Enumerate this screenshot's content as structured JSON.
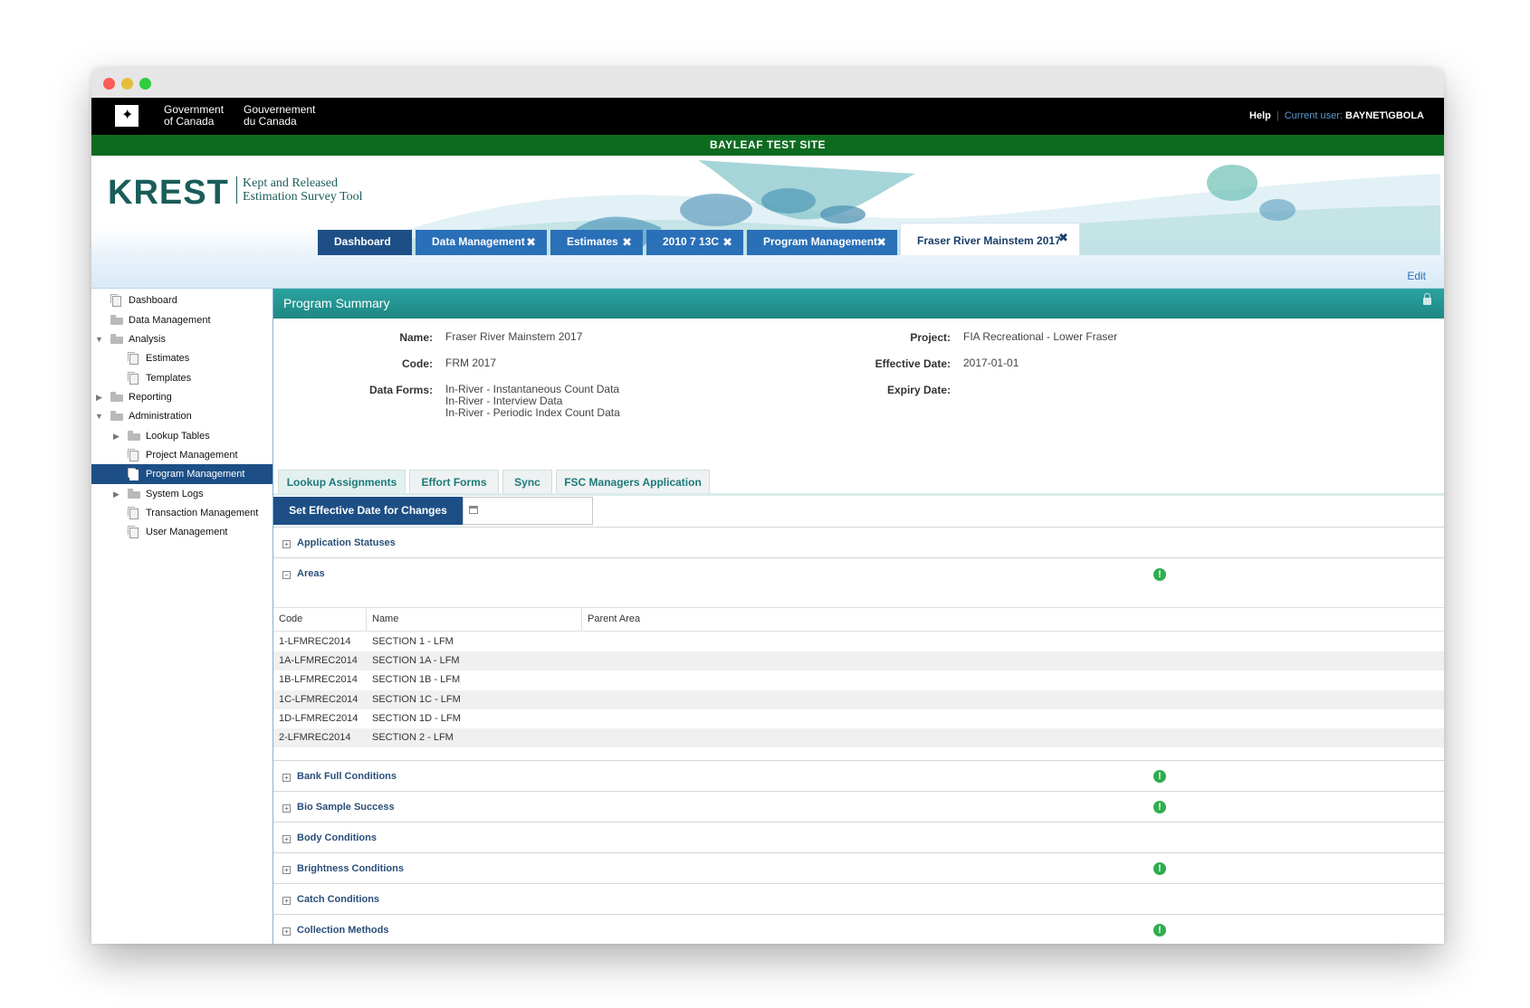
{
  "gov": {
    "en_line1": "Government",
    "en_line2": "of Canada",
    "fr_line1": "Gouvernement",
    "fr_line2": "du Canada",
    "help": "Help",
    "current_user_label": "Current user:",
    "current_user": "BAYNET\\GBOLA"
  },
  "site_banner": "BAYLEAF  TEST  SITE",
  "logo": {
    "name": "KREST",
    "line1": "Kept and Released",
    "line2": "Estimation Survey Tool"
  },
  "tabs": [
    {
      "label": "Dashboard",
      "close": ""
    },
    {
      "label": "Data Management",
      "close": "✖"
    },
    {
      "label": "Estimates",
      "close": "✖"
    },
    {
      "label": "2010 7 13C",
      "close": "✖"
    },
    {
      "label": "Program Management",
      "close": "✖"
    },
    {
      "label": "Fraser River Mainstem 2017",
      "close": "✖"
    }
  ],
  "edit_label": "Edit",
  "sidebar": [
    {
      "label": "Dashboard"
    },
    {
      "label": "Data Management"
    },
    {
      "label": "Analysis"
    },
    {
      "label": "Estimates"
    },
    {
      "label": "Templates"
    },
    {
      "label": "Reporting"
    },
    {
      "label": "Administration"
    },
    {
      "label": "Lookup Tables"
    },
    {
      "label": "Project Management"
    },
    {
      "label": "Program Management"
    },
    {
      "label": "System Logs"
    },
    {
      "label": "Transaction Management"
    },
    {
      "label": "User Management"
    }
  ],
  "summary": {
    "title": "Program Summary",
    "name_label": "Name:",
    "name": "Fraser River Mainstem 2017",
    "code_label": "Code:",
    "code": "FRM 2017",
    "forms_label": "Data Forms:",
    "forms": [
      "In-River - Instantaneous Count Data",
      "In-River - Interview Data",
      "In-River - Periodic Index Count Data"
    ],
    "project_label": "Project:",
    "project": "FIA Recreational - Lower Fraser",
    "effective_label": "Effective Date:",
    "effective": "2017-01-01",
    "expiry_label": "Expiry Date:"
  },
  "sub_tabs": [
    "Lookup Assignments",
    "Effort Forms",
    "Sync",
    "FSC Managers Application"
  ],
  "set_date_label": "Set Effective Date for Changes",
  "sections": [
    {
      "title": "Application Statuses",
      "toggle": "+"
    },
    {
      "title": "Areas",
      "toggle": "−"
    },
    {
      "title": "Bank Full Conditions",
      "toggle": "+"
    },
    {
      "title": "Bio Sample Success",
      "toggle": "+"
    },
    {
      "title": "Body Conditions",
      "toggle": "+"
    },
    {
      "title": "Brightness Conditions",
      "toggle": "+"
    },
    {
      "title": "Catch Conditions",
      "toggle": "+"
    },
    {
      "title": "Collection Methods",
      "toggle": "+"
    }
  ],
  "warn_glyph": "!",
  "areas_grid": {
    "headers": [
      "Code",
      "Name",
      "Parent Area"
    ],
    "rows": [
      [
        "1-LFMREC2014",
        "SECTION 1 - LFM"
      ],
      [
        "1A-LFMREC2014",
        "SECTION 1A - LFM"
      ],
      [
        "1B-LFMREC2014",
        "SECTION 1B - LFM"
      ],
      [
        "1C-LFMREC2014",
        "SECTION 1C - LFM"
      ],
      [
        "1D-LFMREC2014",
        "SECTION 1D - LFM"
      ],
      [
        "2-LFMREC2014",
        "SECTION 2 - LFM"
      ]
    ]
  }
}
